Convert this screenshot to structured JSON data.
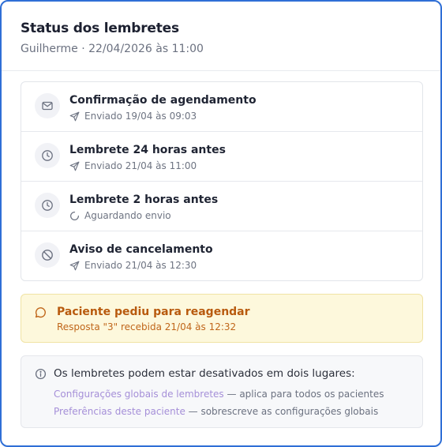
{
  "header": {
    "title": "Status dos lembretes",
    "subtitle": "Guilherme · 22/04/2026 às 11:00"
  },
  "reminders": [
    {
      "icon": "mail-icon",
      "title": "Confirmação de agendamento",
      "status_icon": "send-icon",
      "status": "Enviado 19/04 às 09:03"
    },
    {
      "icon": "clock-icon",
      "title": "Lembrete 24 horas antes",
      "status_icon": "send-icon",
      "status": "Enviado 21/04 às 11:00"
    },
    {
      "icon": "clock-icon",
      "title": "Lembrete 2 horas antes",
      "status_icon": "spinner-icon",
      "status": "Aguardando envio"
    },
    {
      "icon": "ban-icon",
      "title": "Aviso de cancelamento",
      "status_icon": "send-icon",
      "status": "Enviado 21/04 às 12:30"
    }
  ],
  "alert": {
    "icon": "message-circle-icon",
    "title": "Paciente pediu para reagendar",
    "subtitle": "Resposta \"3\" recebida 21/04 às 12:32"
  },
  "info": {
    "icon": "info-icon",
    "text": "Os lembretes podem estar desativados em dois lugares:",
    "links": [
      {
        "label": "Configurações globais de lembretes",
        "suffix": " — aplica para todos os pacientes"
      },
      {
        "label": "Preferências deste paciente",
        "suffix": " — sobrescreve as configurações globais"
      }
    ]
  },
  "colors": {
    "frame_border": "#2f6fd6",
    "alert_bg": "#fdf8dc",
    "alert_text": "#b85a0e",
    "link": "#a58fd8"
  }
}
